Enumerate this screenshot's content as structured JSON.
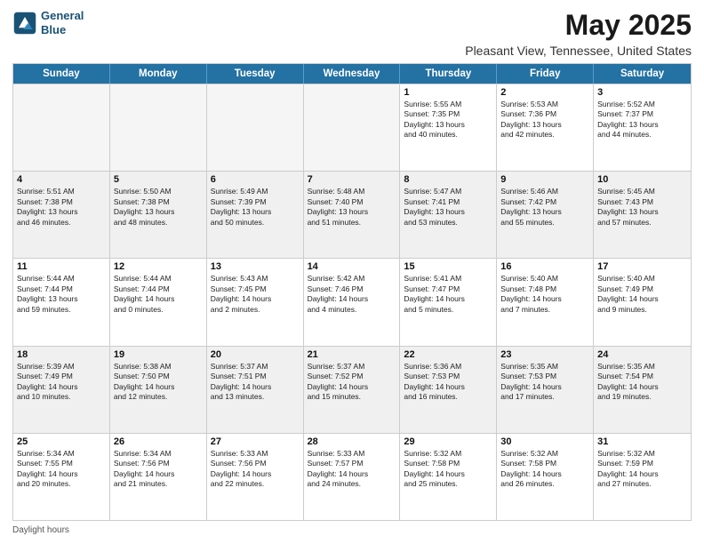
{
  "header": {
    "logo_line1": "General",
    "logo_line2": "Blue",
    "main_title": "May 2025",
    "sub_title": "Pleasant View, Tennessee, United States"
  },
  "calendar": {
    "days_of_week": [
      "Sunday",
      "Monday",
      "Tuesday",
      "Wednesday",
      "Thursday",
      "Friday",
      "Saturday"
    ],
    "weeks": [
      [
        {
          "day": "",
          "info": "",
          "empty": true
        },
        {
          "day": "",
          "info": "",
          "empty": true
        },
        {
          "day": "",
          "info": "",
          "empty": true
        },
        {
          "day": "",
          "info": "",
          "empty": true
        },
        {
          "day": "1",
          "info": "Sunrise: 5:55 AM\nSunset: 7:35 PM\nDaylight: 13 hours\nand 40 minutes."
        },
        {
          "day": "2",
          "info": "Sunrise: 5:53 AM\nSunset: 7:36 PM\nDaylight: 13 hours\nand 42 minutes."
        },
        {
          "day": "3",
          "info": "Sunrise: 5:52 AM\nSunset: 7:37 PM\nDaylight: 13 hours\nand 44 minutes."
        }
      ],
      [
        {
          "day": "4",
          "info": "Sunrise: 5:51 AM\nSunset: 7:38 PM\nDaylight: 13 hours\nand 46 minutes."
        },
        {
          "day": "5",
          "info": "Sunrise: 5:50 AM\nSunset: 7:38 PM\nDaylight: 13 hours\nand 48 minutes."
        },
        {
          "day": "6",
          "info": "Sunrise: 5:49 AM\nSunset: 7:39 PM\nDaylight: 13 hours\nand 50 minutes."
        },
        {
          "day": "7",
          "info": "Sunrise: 5:48 AM\nSunset: 7:40 PM\nDaylight: 13 hours\nand 51 minutes."
        },
        {
          "day": "8",
          "info": "Sunrise: 5:47 AM\nSunset: 7:41 PM\nDaylight: 13 hours\nand 53 minutes."
        },
        {
          "day": "9",
          "info": "Sunrise: 5:46 AM\nSunset: 7:42 PM\nDaylight: 13 hours\nand 55 minutes."
        },
        {
          "day": "10",
          "info": "Sunrise: 5:45 AM\nSunset: 7:43 PM\nDaylight: 13 hours\nand 57 minutes."
        }
      ],
      [
        {
          "day": "11",
          "info": "Sunrise: 5:44 AM\nSunset: 7:44 PM\nDaylight: 13 hours\nand 59 minutes."
        },
        {
          "day": "12",
          "info": "Sunrise: 5:44 AM\nSunset: 7:44 PM\nDaylight: 14 hours\nand 0 minutes."
        },
        {
          "day": "13",
          "info": "Sunrise: 5:43 AM\nSunset: 7:45 PM\nDaylight: 14 hours\nand 2 minutes."
        },
        {
          "day": "14",
          "info": "Sunrise: 5:42 AM\nSunset: 7:46 PM\nDaylight: 14 hours\nand 4 minutes."
        },
        {
          "day": "15",
          "info": "Sunrise: 5:41 AM\nSunset: 7:47 PM\nDaylight: 14 hours\nand 5 minutes."
        },
        {
          "day": "16",
          "info": "Sunrise: 5:40 AM\nSunset: 7:48 PM\nDaylight: 14 hours\nand 7 minutes."
        },
        {
          "day": "17",
          "info": "Sunrise: 5:40 AM\nSunset: 7:49 PM\nDaylight: 14 hours\nand 9 minutes."
        }
      ],
      [
        {
          "day": "18",
          "info": "Sunrise: 5:39 AM\nSunset: 7:49 PM\nDaylight: 14 hours\nand 10 minutes."
        },
        {
          "day": "19",
          "info": "Sunrise: 5:38 AM\nSunset: 7:50 PM\nDaylight: 14 hours\nand 12 minutes."
        },
        {
          "day": "20",
          "info": "Sunrise: 5:37 AM\nSunset: 7:51 PM\nDaylight: 14 hours\nand 13 minutes."
        },
        {
          "day": "21",
          "info": "Sunrise: 5:37 AM\nSunset: 7:52 PM\nDaylight: 14 hours\nand 15 minutes."
        },
        {
          "day": "22",
          "info": "Sunrise: 5:36 AM\nSunset: 7:53 PM\nDaylight: 14 hours\nand 16 minutes."
        },
        {
          "day": "23",
          "info": "Sunrise: 5:35 AM\nSunset: 7:53 PM\nDaylight: 14 hours\nand 17 minutes."
        },
        {
          "day": "24",
          "info": "Sunrise: 5:35 AM\nSunset: 7:54 PM\nDaylight: 14 hours\nand 19 minutes."
        }
      ],
      [
        {
          "day": "25",
          "info": "Sunrise: 5:34 AM\nSunset: 7:55 PM\nDaylight: 14 hours\nand 20 minutes."
        },
        {
          "day": "26",
          "info": "Sunrise: 5:34 AM\nSunset: 7:56 PM\nDaylight: 14 hours\nand 21 minutes."
        },
        {
          "day": "27",
          "info": "Sunrise: 5:33 AM\nSunset: 7:56 PM\nDaylight: 14 hours\nand 22 minutes."
        },
        {
          "day": "28",
          "info": "Sunrise: 5:33 AM\nSunset: 7:57 PM\nDaylight: 14 hours\nand 24 minutes."
        },
        {
          "day": "29",
          "info": "Sunrise: 5:32 AM\nSunset: 7:58 PM\nDaylight: 14 hours\nand 25 minutes."
        },
        {
          "day": "30",
          "info": "Sunrise: 5:32 AM\nSunset: 7:58 PM\nDaylight: 14 hours\nand 26 minutes."
        },
        {
          "day": "31",
          "info": "Sunrise: 5:32 AM\nSunset: 7:59 PM\nDaylight: 14 hours\nand 27 minutes."
        }
      ]
    ]
  },
  "footer": {
    "label": "Daylight hours"
  }
}
